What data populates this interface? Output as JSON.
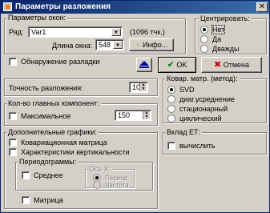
{
  "window": {
    "title": "Параметры разложения",
    "close_glyph": "✕"
  },
  "window_params": {
    "title": "Параметры окон:",
    "series_label": "Ряд:",
    "series_value": "Var1",
    "series_count": "(1096 тчк.)",
    "window_length_label": "Длина окна:",
    "window_length_value": "548",
    "info_button": "Инфо..."
  },
  "center": {
    "title": "Центрировать:",
    "options": [
      "Нет",
      "Да",
      "Дважды"
    ],
    "selected": "Нет"
  },
  "gap_detection": {
    "label": "Обнаружение разладки",
    "checked": false
  },
  "buttons": {
    "ok": "OK",
    "cancel": "Отмена",
    "up_arrow": "up-arrow"
  },
  "accuracy": {
    "label": "Точность разложения:",
    "value": "10"
  },
  "components": {
    "title": "Кол-во главных компонент:",
    "max_label": "Максимальное",
    "max_checked": false,
    "value": "150"
  },
  "cov_method": {
    "title": "Ковар. матр. (метод):",
    "options": [
      "SVD",
      "диаг.усреднение",
      "стационарный",
      "циклический"
    ],
    "selected": "SVD"
  },
  "extra_graphs": {
    "title": "Дополнительные графики:",
    "cov_matrix": "Ковариационная матрица",
    "vert_chars": "Характеристики вертикальности",
    "periodograms": {
      "title": "Периодограммы:",
      "average": "Среднее",
      "axis_title": "Ось X:",
      "axis_options": [
        "Период",
        "Частота"
      ]
    },
    "matrix": "Матрица"
  },
  "et_contribution": {
    "title": "Вклад ЕТ:",
    "compute": "вычислить"
  },
  "colors": {
    "title_start": "#0a246a",
    "title_end": "#3a6ea5",
    "face": "#d4d0c8",
    "ok_check": "#008000",
    "cancel_x": "#c00000",
    "arrow": "#0000a0"
  }
}
